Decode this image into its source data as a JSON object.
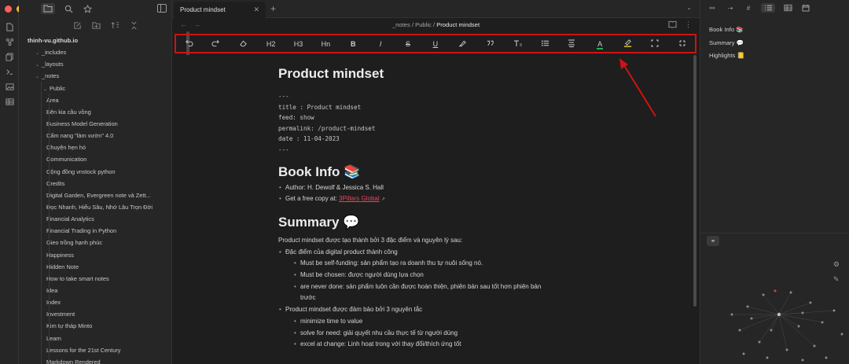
{
  "colors": {
    "accent_red": "#d01212",
    "link": "#e8455a",
    "traffic_red": "#ff5f57",
    "traffic_yellow": "#febc2e",
    "traffic_green": "#28c840"
  },
  "sidebar": {
    "vault_name": "thinh-vu.github.io",
    "folders": [
      "_includes",
      "_layouts",
      "_notes",
      "Public"
    ],
    "files": [
      "Area",
      "Bên kia cầu vồng",
      "Business Model Generation",
      "Cẩm nang \"làm vườn\" 4.0",
      "Chuyện hẹn hò",
      "Communication",
      "Cộng đồng vnstock python",
      "Credits",
      "Digital Garden, Evergreen note và Zett...",
      "Đọc Nhanh, Hiểu Sâu, Nhớ Lâu Trọn Đời",
      "Financial Analytics",
      "Financial Trading in Python",
      "Gieo trồng hạnh phúc",
      "Happiness",
      "Hidden Note",
      "How to take smart notes",
      "Idea",
      "Index",
      "Investment",
      "Kim tự tháp Minto",
      "Learn",
      "Lessons for the 21st Century",
      "Markdown Rendered"
    ]
  },
  "tab": {
    "title": "Product mindset"
  },
  "breadcrumb": {
    "part1": "_notes",
    "sep": "/",
    "part2": "Public",
    "current": "Product mindset"
  },
  "toolbar": {
    "h2": "H2",
    "h3": "H3",
    "hn": "Hn",
    "bold": "B",
    "italic": "I",
    "strike": "S",
    "underline": "U",
    "text_color": "A"
  },
  "note": {
    "title": "Product mindset",
    "frontmatter": [
      "---",
      "title : Product mindset",
      "feed: show",
      "permalink: /product-mindset",
      "date : 11-04-2023",
      "---"
    ],
    "book_info_heading": "Book Info 📚",
    "author": "Author: H. Dewolf & Jessica S. Hall",
    "copy_prefix": "Get a free copy at: ",
    "copy_link": "3Pillars Global",
    "summary_heading": "Summary 💬",
    "summary_intro": "Product mindset được tạo thành bởi 3 đặc điểm và nguyên lý sau:",
    "b1": "Đặc điểm của digital product thành công",
    "b1_1": "Must be self-funding: sản phẩm tạo ra doanh thu tự nuôi sống nó.",
    "b1_2": "Must be chosen: được người dùng lựa chọn",
    "b1_3a": "are never done: sản phẩm luôn cần được hoàn thiện, phiên bản sau tốt hơn phiên bản",
    "b1_3b": "trước",
    "b2": "Product mindset được đảm bảo bởi 3 nguyên tắc",
    "b2_1": "minimize time to value",
    "b2_2": "solve for need: giải quyết nhu cầu thực tế từ người dùng",
    "b2_3": "excel at change: Linh hoạt trong với thay đổi/thích ứng tốt"
  },
  "outline": [
    "Book Info 📚",
    "Summary 💬",
    "Highlights 📒"
  ]
}
